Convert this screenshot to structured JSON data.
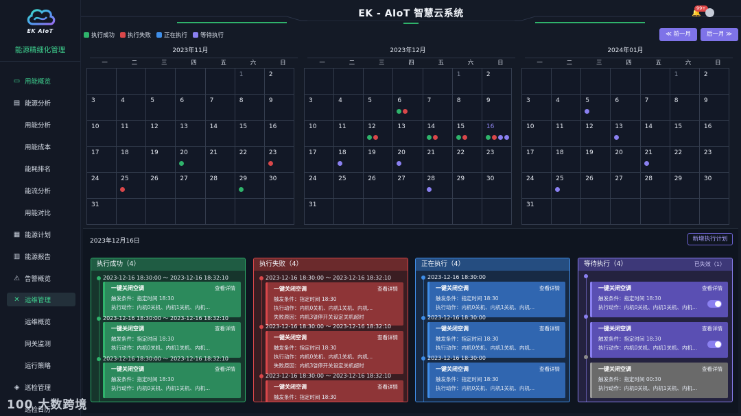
{
  "app": {
    "title": "EK - AIoT 智慧云系统",
    "logo_text": "EK AIoT",
    "notification_badge": "99+"
  },
  "sidebar": {
    "title": "能源精细化管理",
    "items": [
      {
        "label": "用能概览",
        "icon": "monitor-icon",
        "level": 0,
        "state": "active"
      },
      {
        "label": "能源分析",
        "icon": "analysis-icon",
        "level": 0
      },
      {
        "label": "用能分析",
        "level": 1
      },
      {
        "label": "用能成本",
        "level": 1
      },
      {
        "label": "能耗排名",
        "level": 1
      },
      {
        "label": "能流分析",
        "level": 1
      },
      {
        "label": "用能对比",
        "level": 1
      },
      {
        "label": "能源计划",
        "icon": "calendar-icon",
        "level": 0
      },
      {
        "label": "能源报告",
        "icon": "report-icon",
        "level": 0
      },
      {
        "label": "告警概览",
        "icon": "warning-icon",
        "level": 0
      },
      {
        "label": "运维管理",
        "icon": "tools-icon",
        "level": 0,
        "state": "selected"
      },
      {
        "label": "运维概览",
        "level": 1
      },
      {
        "label": "网关监测",
        "level": 1
      },
      {
        "label": "运行策略",
        "level": 1
      },
      {
        "label": "巡检管理",
        "icon": "inspect-icon",
        "level": 0
      },
      {
        "label": "巡检日历",
        "level": 1
      }
    ]
  },
  "legend": [
    {
      "label": "执行成功",
      "color": "#2fb36b"
    },
    {
      "label": "执行失败",
      "color": "#d9474a"
    },
    {
      "label": "正在执行",
      "color": "#3f8ee8"
    },
    {
      "label": "等待执行",
      "color": "#8a80f0"
    }
  ],
  "nav": {
    "prev": "≪ 前一月",
    "next": "后一月 ≫"
  },
  "weekdays": [
    "一",
    "二",
    "三",
    "四",
    "五",
    "六",
    "日"
  ],
  "calendars": [
    {
      "title": "2023年11月",
      "cells": [
        {
          "d": ""
        },
        {
          "d": ""
        },
        {
          "d": ""
        },
        {
          "d": ""
        },
        {
          "d": ""
        },
        {
          "d": "1",
          "muted": true
        },
        {
          "d": "2"
        },
        {
          "d": "3"
        },
        {
          "d": "4"
        },
        {
          "d": "5"
        },
        {
          "d": "6"
        },
        {
          "d": "7"
        },
        {
          "d": "8"
        },
        {
          "d": "9"
        },
        {
          "d": "10"
        },
        {
          "d": "11"
        },
        {
          "d": "12"
        },
        {
          "d": "13"
        },
        {
          "d": "14"
        },
        {
          "d": "15"
        },
        {
          "d": "16"
        },
        {
          "d": "17"
        },
        {
          "d": "18"
        },
        {
          "d": "19"
        },
        {
          "d": "20",
          "dots": [
            "success"
          ]
        },
        {
          "d": "21"
        },
        {
          "d": "22"
        },
        {
          "d": "23",
          "dots": [
            "fail"
          ]
        },
        {
          "d": "24"
        },
        {
          "d": "25",
          "dots": [
            "fail"
          ]
        },
        {
          "d": "26"
        },
        {
          "d": "27"
        },
        {
          "d": "28"
        },
        {
          "d": "29",
          "dots": [
            "success"
          ]
        },
        {
          "d": "30"
        },
        {
          "d": "31"
        },
        {
          "d": ""
        },
        {
          "d": ""
        },
        {
          "d": ""
        },
        {
          "d": ""
        },
        {
          "d": ""
        },
        {
          "d": ""
        }
      ]
    },
    {
      "title": "2023年12月",
      "cells": [
        {
          "d": ""
        },
        {
          "d": ""
        },
        {
          "d": ""
        },
        {
          "d": ""
        },
        {
          "d": ""
        },
        {
          "d": "1",
          "muted": true
        },
        {
          "d": "2"
        },
        {
          "d": "3"
        },
        {
          "d": "4"
        },
        {
          "d": "5"
        },
        {
          "d": "6",
          "dots": [
            "success",
            "fail"
          ]
        },
        {
          "d": "7"
        },
        {
          "d": "8"
        },
        {
          "d": "9"
        },
        {
          "d": "10"
        },
        {
          "d": "11"
        },
        {
          "d": "12",
          "dots": [
            "success",
            "fail"
          ]
        },
        {
          "d": "13"
        },
        {
          "d": "14",
          "dots": [
            "success",
            "fail"
          ]
        },
        {
          "d": "15",
          "dots": [
            "success",
            "fail"
          ]
        },
        {
          "d": "16",
          "hl": true,
          "dots": [
            "success",
            "fail",
            "waiting",
            "waiting"
          ]
        },
        {
          "d": "17"
        },
        {
          "d": "18",
          "dots": [
            "waiting"
          ]
        },
        {
          "d": "19"
        },
        {
          "d": "20",
          "dots": [
            "waiting"
          ]
        },
        {
          "d": "21"
        },
        {
          "d": "22"
        },
        {
          "d": "23"
        },
        {
          "d": "24"
        },
        {
          "d": "25"
        },
        {
          "d": "26"
        },
        {
          "d": "27"
        },
        {
          "d": "28",
          "dots": [
            "waiting"
          ]
        },
        {
          "d": "29"
        },
        {
          "d": "30"
        },
        {
          "d": "31"
        },
        {
          "d": ""
        },
        {
          "d": ""
        },
        {
          "d": ""
        },
        {
          "d": ""
        },
        {
          "d": ""
        },
        {
          "d": ""
        }
      ]
    },
    {
      "title": "2024年01月",
      "cells": [
        {
          "d": ""
        },
        {
          "d": ""
        },
        {
          "d": ""
        },
        {
          "d": ""
        },
        {
          "d": ""
        },
        {
          "d": "1",
          "muted": true
        },
        {
          "d": "2"
        },
        {
          "d": "3"
        },
        {
          "d": "4"
        },
        {
          "d": "5",
          "dots": [
            "waiting"
          ]
        },
        {
          "d": "6"
        },
        {
          "d": "7"
        },
        {
          "d": "8"
        },
        {
          "d": "9"
        },
        {
          "d": "10"
        },
        {
          "d": "11"
        },
        {
          "d": "12"
        },
        {
          "d": "13",
          "dots": [
            "waiting"
          ]
        },
        {
          "d": "14"
        },
        {
          "d": "15"
        },
        {
          "d": "16"
        },
        {
          "d": "17"
        },
        {
          "d": "18"
        },
        {
          "d": "19"
        },
        {
          "d": "20"
        },
        {
          "d": "21",
          "dots": [
            "waiting"
          ]
        },
        {
          "d": "22"
        },
        {
          "d": "23"
        },
        {
          "d": "24"
        },
        {
          "d": "25",
          "dots": [
            "waiting"
          ]
        },
        {
          "d": "26"
        },
        {
          "d": "27"
        },
        {
          "d": "28"
        },
        {
          "d": "29"
        },
        {
          "d": "30"
        },
        {
          "d": "31"
        },
        {
          "d": ""
        },
        {
          "d": ""
        },
        {
          "d": ""
        },
        {
          "d": ""
        },
        {
          "d": ""
        },
        {
          "d": ""
        }
      ]
    }
  ],
  "dot_colors": {
    "success": "#2fb36b",
    "fail": "#d9474a",
    "running": "#3f8ee8",
    "waiting": "#8a80f0"
  },
  "bottom": {
    "selected_date": "2023年12月16日",
    "new_plan": "新增执行计划",
    "columns": [
      {
        "key": "success",
        "title": "执行成功（4）",
        "head_bg": "#1f5c43",
        "border": "#2fb36b",
        "body_bg": "#16352c",
        "card_bg": "#2c8a5c",
        "dot": "#2fb36b",
        "entries": [
          {
            "time": "2023-12-16 18:30:00 ～ 2023-12-16 18:32:10",
            "title": "一键关闭空调",
            "detail": "查看详情",
            "lines": [
              "触发条件：指定时间 18:30",
              "执行动作：内机0关机、内机1关机、内机..."
            ]
          },
          {
            "time": "2023-12-16 18:30:00 ～ 2023-12-16 18:32:10",
            "title": "一键关闭空调",
            "detail": "查看详情",
            "lines": [
              "触发条件：指定时间 18:30",
              "执行动作：内机0关机、内机1关机、内机..."
            ]
          },
          {
            "time": "2023-12-16 18:30:00 ～ 2023-12-16 18:32:10",
            "title": "一键关闭空调",
            "detail": "查看详情",
            "lines": [
              "触发条件：指定时间 18:30",
              "执行动作：内机0关机、内机1关机、内机..."
            ]
          }
        ]
      },
      {
        "key": "fail",
        "title": "执行失败（4）",
        "head_bg": "#6b2a2c",
        "border": "#d9474a",
        "body_bg": "#3a1d22",
        "card_bg": "#8e3537",
        "dot": "#d9474a",
        "entries": [
          {
            "time": "2023-12-16 18:30:00 ～ 2023-12-16 18:32:10",
            "title": "一键关闭空调",
            "detail": "查看详情",
            "lines": [
              "触发条件：指定时间 18:30",
              "执行动作：内机0关机、内机1关机、内机...",
              "失败原因：内机3열停开关设定关机超时"
            ]
          },
          {
            "time": "2023-12-16 18:30:00 ～ 2023-12-16 18:32:10",
            "title": "一键关闭空调",
            "detail": "查看详情",
            "lines": [
              "触发条件：指定时间 18:30",
              "执行动作：内机0关机、内机1关机、内机...",
              "失败原因：内机3열停开关设定关机超时"
            ]
          },
          {
            "time": "2023-12-16 18:30:00 ～ 2023-12-16 18:32:10",
            "title": "一键关闭空调",
            "detail": "查看详情",
            "lines": [
              "触发条件：指定时间 18:30"
            ]
          }
        ]
      },
      {
        "key": "running",
        "title": "正在执行（4）",
        "head_bg": "#254d80",
        "border": "#3f8ee8",
        "body_bg": "#172a44",
        "card_bg": "#3066b0",
        "dot": "#3f8ee8",
        "entries": [
          {
            "time": "2023-12-16 18:30:00",
            "title": "一键关闭空调",
            "detail": "查看详情",
            "lines": [
              "触发条件：指定时间 18:30",
              "执行动作：内机0关机、内机1关机、内机..."
            ]
          },
          {
            "time": "2023-12-16 18:30:00",
            "title": "一键关闭空调",
            "detail": "查看详情",
            "lines": [
              "触发条件：指定时间 18:30",
              "执行动作：内机0关机、内机1关机、内机..."
            ]
          },
          {
            "time": "2023-12-16 18:30:00",
            "title": "一键关闭空调",
            "detail": "查看详情",
            "lines": [
              "触发条件：指定时间 18:30",
              "执行动作：内机0关机、内机1关机、内机..."
            ]
          }
        ]
      },
      {
        "key": "waiting",
        "title": "等待执行（4）",
        "extra": "已失效（1）",
        "head_bg": "#3d3878",
        "border": "#8a80f0",
        "body_bg": "#24223f",
        "card_bg": "#5a4fb3",
        "dot": "#8a80f0",
        "entries": [
          {
            "time": "",
            "title": "一键关闭空调",
            "detail": "查看详情",
            "toggle": true,
            "lines": [
              "触发条件：指定时间 18:30",
              "执行动作：内机0关机、内机1关机、内机..."
            ]
          },
          {
            "time": "",
            "title": "一键关闭空调",
            "detail": "查看详情",
            "toggle": true,
            "lines": [
              "触发条件：指定时间 18:30",
              "执行动作：内机0关机、内机1关机、内机..."
            ]
          },
          {
            "time": "",
            "title": "一键关闭空调",
            "detail": "查看详情",
            "disabled": true,
            "lines": [
              "触发条件：指定时间 00:30",
              "执行动作：内机0关机、内机1关机、内机..."
            ]
          }
        ]
      }
    ]
  },
  "watermark": "100 大数跨境"
}
